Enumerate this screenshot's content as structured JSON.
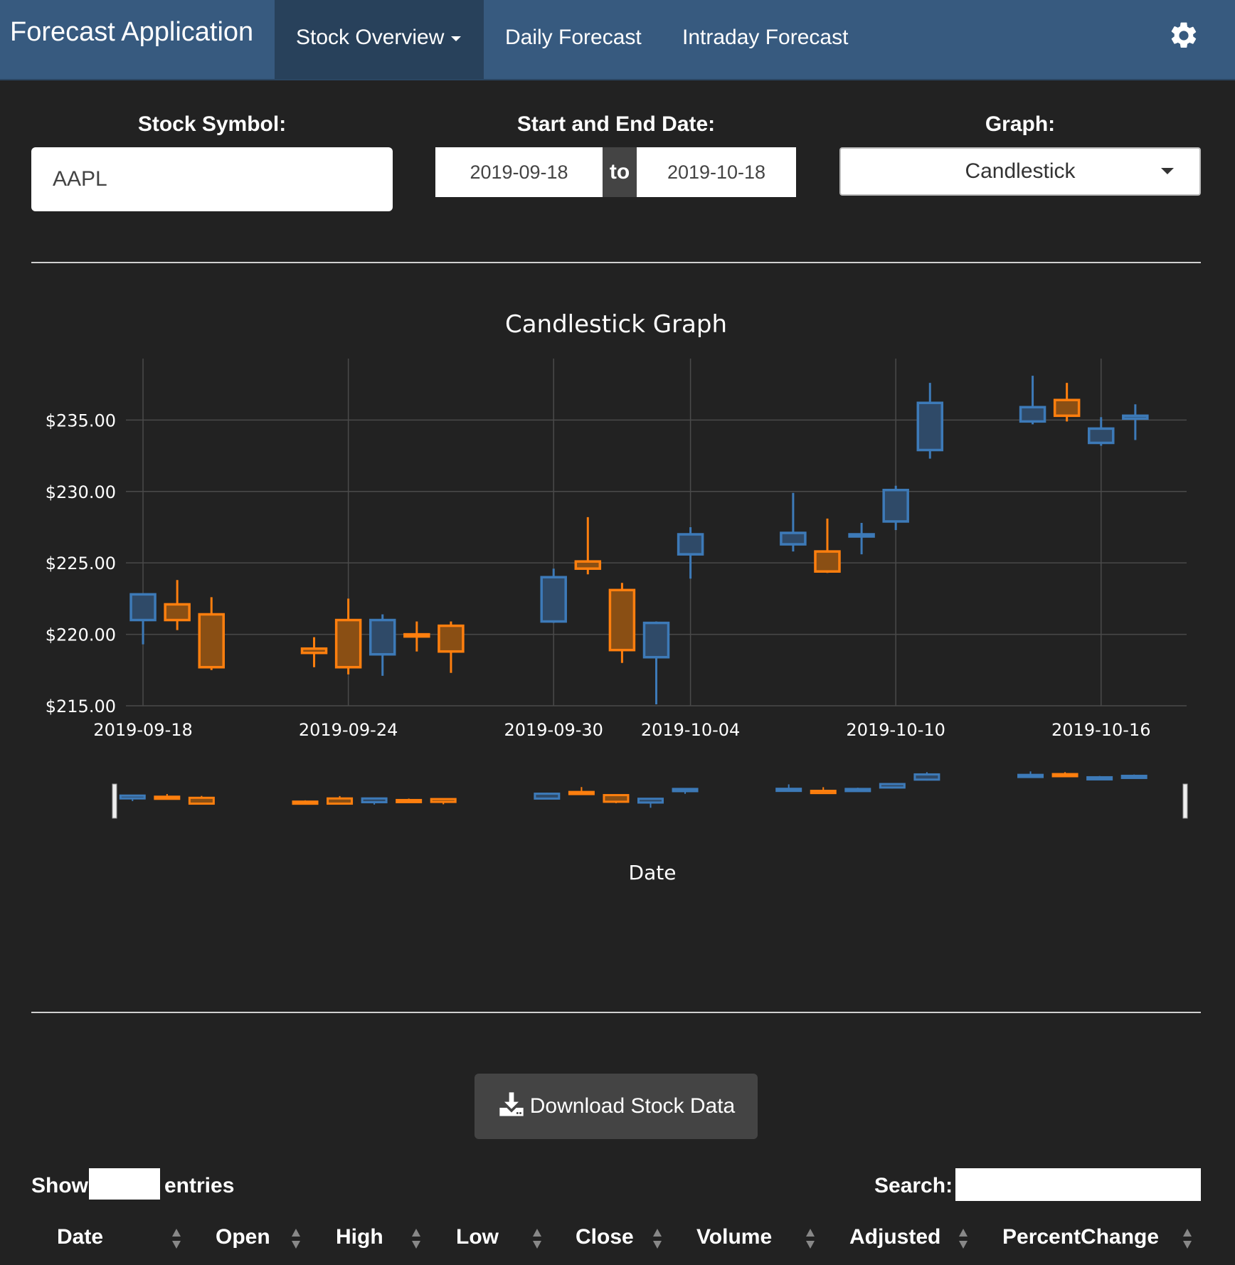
{
  "app": {
    "brand": "Forecast Application",
    "nav": [
      {
        "label": "Stock Overview",
        "active": true,
        "dropdown": true
      },
      {
        "label": "Daily Forecast"
      },
      {
        "label": "Intraday Forecast"
      }
    ],
    "settings_icon": "gear-icon"
  },
  "controls": {
    "symbol_label": "Stock Symbol:",
    "symbol_value": "AAPL",
    "date_label": "Start and End Date:",
    "start_date": "2019-09-18",
    "date_separator": "to",
    "end_date": "2019-10-18",
    "graph_label": "Graph:",
    "graph_value": "Candlestick"
  },
  "chart_data": {
    "type": "candlestick",
    "title": "Candlestick Graph",
    "xlabel": "Date",
    "ylim": [
      215,
      240
    ],
    "y_ticks": [
      "$215.00",
      "$220.00",
      "$225.00",
      "$230.00",
      "$235.00"
    ],
    "x_ticks": [
      "2019-09-18",
      "2019-09-24",
      "2019-09-30",
      "2019-10-04",
      "2019-10-10",
      "2019-10-16"
    ],
    "colors": {
      "increasing": "#3d7ab8",
      "decreasing": "#ff7f0e"
    },
    "grid": true,
    "range_slider": true,
    "candles": [
      {
        "date": "2019-09-18",
        "open": 221.0,
        "high": 222.8,
        "low": 219.3,
        "close": 222.8
      },
      {
        "date": "2019-09-19",
        "open": 222.1,
        "high": 223.8,
        "low": 220.3,
        "close": 221.0
      },
      {
        "date": "2019-09-20",
        "open": 221.4,
        "high": 222.6,
        "low": 217.5,
        "close": 217.7
      },
      {
        "date": "2019-09-23",
        "open": 219.0,
        "high": 219.8,
        "low": 217.7,
        "close": 218.7
      },
      {
        "date": "2019-09-24",
        "open": 221.0,
        "high": 222.5,
        "low": 217.2,
        "close": 217.7
      },
      {
        "date": "2019-09-25",
        "open": 218.6,
        "high": 221.4,
        "low": 217.1,
        "close": 221.0
      },
      {
        "date": "2019-09-26",
        "open": 220.0,
        "high": 220.9,
        "low": 218.8,
        "close": 219.9
      },
      {
        "date": "2019-09-27",
        "open": 220.6,
        "high": 220.9,
        "low": 217.3,
        "close": 218.8
      },
      {
        "date": "2019-09-30",
        "open": 220.9,
        "high": 224.6,
        "low": 220.8,
        "close": 224.0
      },
      {
        "date": "2019-10-01",
        "open": 225.1,
        "high": 228.2,
        "low": 224.2,
        "close": 224.6
      },
      {
        "date": "2019-10-02",
        "open": 223.1,
        "high": 223.6,
        "low": 218.0,
        "close": 218.9
      },
      {
        "date": "2019-10-03",
        "open": 218.4,
        "high": 220.9,
        "low": 215.1,
        "close": 220.8
      },
      {
        "date": "2019-10-04",
        "open": 225.6,
        "high": 227.5,
        "low": 223.9,
        "close": 227.0
      },
      {
        "date": "2019-10-07",
        "open": 226.3,
        "high": 229.9,
        "low": 225.8,
        "close": 227.1
      },
      {
        "date": "2019-10-08",
        "open": 225.8,
        "high": 228.1,
        "low": 224.3,
        "close": 224.4
      },
      {
        "date": "2019-10-09",
        "open": 227.0,
        "high": 227.8,
        "low": 225.6,
        "close": 227.0
      },
      {
        "date": "2019-10-10",
        "open": 227.9,
        "high": 230.4,
        "low": 227.3,
        "close": 230.1
      },
      {
        "date": "2019-10-11",
        "open": 232.9,
        "high": 237.6,
        "low": 232.3,
        "close": 236.2
      },
      {
        "date": "2019-10-14",
        "open": 234.9,
        "high": 238.1,
        "low": 234.7,
        "close": 235.9
      },
      {
        "date": "2019-10-15",
        "open": 236.4,
        "high": 237.6,
        "low": 234.9,
        "close": 235.3
      },
      {
        "date": "2019-10-16",
        "open": 233.4,
        "high": 235.2,
        "low": 233.2,
        "close": 234.4
      },
      {
        "date": "2019-10-17",
        "open": 235.1,
        "high": 236.1,
        "low": 233.6,
        "close": 235.3
      }
    ]
  },
  "download": {
    "label": "Download Stock Data"
  },
  "table": {
    "show_label": "Show",
    "entries_label": "entries",
    "search_label": "Search:",
    "columns": [
      "Date",
      "Open",
      "High",
      "Low",
      "Close",
      "Volume",
      "Adjusted",
      "PercentChange"
    ]
  }
}
